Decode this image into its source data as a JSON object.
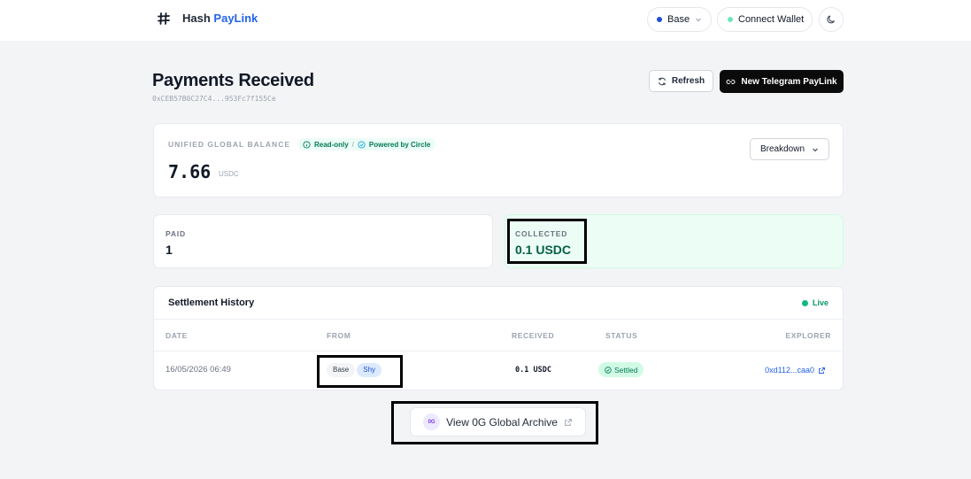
{
  "header": {
    "brand_name": "Hash",
    "brand_accent": "PayLink",
    "network_label": "Base",
    "connect_wallet_label": "Connect Wallet"
  },
  "page": {
    "title": "Payments Received",
    "address": "0xCEB57B0C27C4...953Fc7f155Ce",
    "refresh_label": "Refresh",
    "new_paylink_label": "New Telegram PayLink"
  },
  "balance": {
    "label": "UNIFIED GLOBAL BALANCE",
    "readonly_label": "Read-only",
    "separator": "/",
    "powered_label": "Powered by Circle",
    "value": "7.66",
    "unit": "USDC",
    "breakdown_label": "Breakdown"
  },
  "stats": {
    "paid_label": "PAID",
    "paid_value": "1",
    "collected_label": "COLLECTED",
    "collected_value": "0.1 USDC"
  },
  "history": {
    "title": "Settlement History",
    "live_label": "Live",
    "columns": {
      "date": "DATE",
      "from": "FROM",
      "received": "RECEIVED",
      "status": "STATUS",
      "explorer": "EXPLORER"
    },
    "rows": [
      {
        "date": "16/05/2026 06:49",
        "from_chain": "Base",
        "from_tag": "Shy",
        "received": "0.1 USDC",
        "status": "Settled",
        "explorer": "0xd112...caa0"
      }
    ]
  },
  "archive": {
    "badge": "0G",
    "label": "View 0G Global Archive"
  },
  "colors": {
    "brand_accent": "#2563eb",
    "live_green": "#10b981",
    "network_dot": "#1d4ed8",
    "wallet_dot": "#6ee7b7",
    "highlight_border": "#000000"
  },
  "icons": {
    "brand": "hash-icon",
    "refresh": "refresh-icon",
    "link": "link-icon",
    "theme": "moon-icon",
    "external": "external-link-icon"
  }
}
